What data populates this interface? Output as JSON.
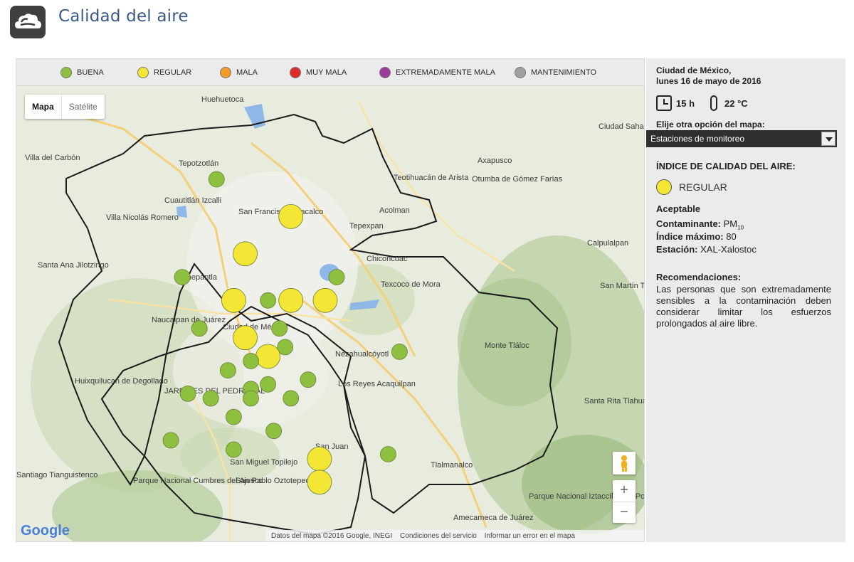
{
  "header": {
    "title": "Calidad del aire"
  },
  "legend": [
    {
      "label": "BUENA",
      "color": "#8dc03f"
    },
    {
      "label": "REGULAR",
      "color": "#f4e634"
    },
    {
      "label": "MALA",
      "color": "#f39a2b"
    },
    {
      "label": "MUY MALA",
      "color": "#e02b2b"
    },
    {
      "label": "EXTREMADAMENTE MALA",
      "color": "#9b3b9a"
    },
    {
      "label": "MANTENIMIENTO",
      "color": "#a0a0a0"
    }
  ],
  "map": {
    "type_control": {
      "map_label": "Mapa",
      "satellite_label": "Satélite"
    },
    "zoom_in": "+",
    "zoom_out": "−",
    "google_logo": "Google",
    "attribution": {
      "data": "Datos del mapa ©2016 Google, INEGI",
      "terms": "Condiciones del servicio",
      "report": "Informar un error en el mapa"
    },
    "places": [
      "Huehuetoca",
      "Ciudad Sahagún",
      "Villa del Carbón",
      "Tepotzotlán",
      "Axapusco",
      "Otumba de Gómez Farías",
      "Teotihuacán de Arista",
      "Cuautitlán Izcalli",
      "San Francisco Coacalco",
      "Villa Nicolás Romero",
      "Acolman",
      "Tepexpan",
      "Calpulalpan",
      "Santa Ana Jilotzingo",
      "Chiconcuac",
      "Tlalnepantla",
      "Texcoco de Mora",
      "Naucalpan de Juárez",
      "Ciudad de México",
      "Nezahualcóyotl",
      "Los Reyes Acaquilpan",
      "Huixquilucan de Degollado",
      "Monte Tláloc",
      "JARDINES DEL PEDREGAL",
      "Santa Rita Tlahuapan",
      "San Miguel Topilejo",
      "San Pablo Oztotepec",
      "San Juan",
      "Tlalmanalco",
      "Santiago Tianguistenco",
      "Amecameca de Juárez",
      "Parque Nacional Cumbres del Ajusco",
      "Parque Nacional Iztaccíhuatl - Popocatépetl",
      "San Martín Texmelucan"
    ],
    "stations": [
      {
        "status": "buena",
        "lat": 19.8,
        "lon": -99.23
      },
      {
        "status": "regular",
        "lat": 19.72,
        "lon": -99.1
      },
      {
        "status": "regular",
        "lat": 19.64,
        "lon": -99.18
      },
      {
        "status": "buena",
        "lat": 19.59,
        "lon": -99.29
      },
      {
        "status": "buena",
        "lat": 19.59,
        "lon": -99.02
      },
      {
        "status": "regular",
        "lat": 19.54,
        "lon": -99.2
      },
      {
        "status": "buena",
        "lat": 19.54,
        "lon": -99.14
      },
      {
        "status": "regular",
        "lat": 19.54,
        "lon": -99.1
      },
      {
        "status": "regular",
        "lat": 19.54,
        "lon": -99.04
      },
      {
        "status": "buena",
        "lat": 19.48,
        "lon": -99.26
      },
      {
        "status": "regular",
        "lat": 19.46,
        "lon": -99.18
      },
      {
        "status": "buena",
        "lat": 19.48,
        "lon": -99.12
      },
      {
        "status": "buena",
        "lat": 19.44,
        "lon": -99.11
      },
      {
        "status": "regular",
        "lat": 19.42,
        "lon": -99.14
      },
      {
        "status": "buena",
        "lat": 19.41,
        "lon": -99.17
      },
      {
        "status": "buena",
        "lat": 19.39,
        "lon": -99.21
      },
      {
        "status": "buena",
        "lat": 19.37,
        "lon": -99.07
      },
      {
        "status": "buena",
        "lat": 19.36,
        "lon": -99.14
      },
      {
        "status": "buena",
        "lat": 19.35,
        "lon": -99.17
      },
      {
        "status": "buena",
        "lat": 19.34,
        "lon": -99.28
      },
      {
        "status": "buena",
        "lat": 19.33,
        "lon": -99.24
      },
      {
        "status": "buena",
        "lat": 19.33,
        "lon": -99.17
      },
      {
        "status": "buena",
        "lat": 19.33,
        "lon": -99.1
      },
      {
        "status": "buena",
        "lat": 19.29,
        "lon": -99.2
      },
      {
        "status": "buena",
        "lat": 19.26,
        "lon": -99.13
      },
      {
        "status": "buena",
        "lat": 19.24,
        "lon": -99.31
      },
      {
        "status": "buena",
        "lat": 19.22,
        "lon": -99.2
      },
      {
        "status": "regular",
        "lat": 19.2,
        "lon": -99.05
      },
      {
        "status": "buena",
        "lat": 19.21,
        "lon": -98.93
      },
      {
        "status": "regular",
        "lat": 19.15,
        "lon": -99.05
      },
      {
        "status": "buena",
        "lat": 19.43,
        "lon": -98.91
      }
    ]
  },
  "panel": {
    "location": "Ciudad de México,",
    "date": "lunes 16 de mayo de 2016",
    "hour": "15 h",
    "temperature": "22 °C",
    "map_option_label": "Elije otra opción del mapa:",
    "map_option_selected": "Estaciones de monitoreo",
    "index_title": "ÍNDICE DE CALIDAD DEL AIRE:",
    "index_value": "REGULAR",
    "quality": "Aceptable",
    "pollutant_label": "Contaminante:",
    "pollutant_value": "PM",
    "pollutant_sub": "10",
    "max_index_label": "Índice máximo:",
    "max_index_value": "80",
    "station_label": "Estación:",
    "station_value": "XAL-Xalostoc",
    "recommendations_title": "Recomendaciones:",
    "recommendations_text": "Las personas que son extremadamente sensibles a la contaminación deben considerar limitar los esfuerzos prolongados al aire libre."
  }
}
